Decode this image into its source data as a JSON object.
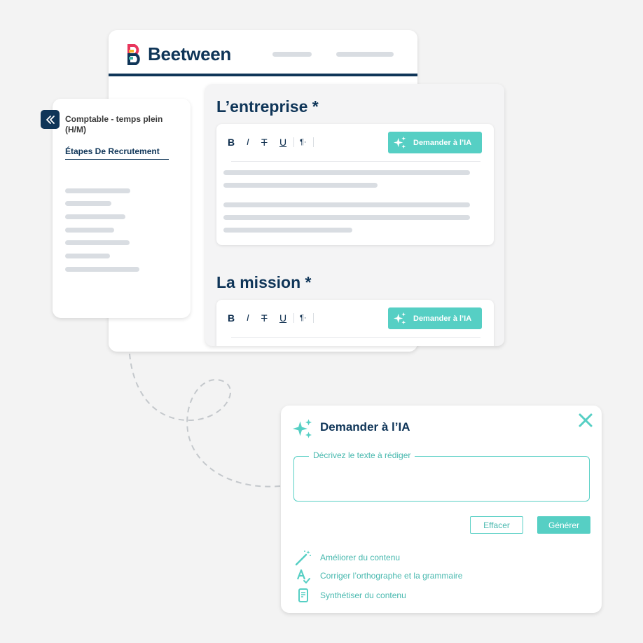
{
  "app": {
    "brand_name": "Beetween"
  },
  "sidebar": {
    "job_title": "Comptable - temps plein (H/M)",
    "steps_link": "Étapes De Recrutement"
  },
  "form": {
    "sections": [
      {
        "title": "L’entreprise *",
        "ai_button": "Demander à l’IA"
      },
      {
        "title": "La mission *",
        "ai_button": "Demander à l’IA"
      }
    ],
    "toolbar": {
      "bold": "B",
      "italic": "I",
      "strike": "T",
      "underline": "U",
      "paragraph": "¶·"
    }
  },
  "ai_dialog": {
    "title": "Demander à l’IA",
    "input_label": "Décrivez le texte à rédiger",
    "input_value": "",
    "clear_button": "Effacer",
    "generate_button": "Générer",
    "actions": [
      {
        "icon": "magic-wand-icon",
        "label": "Améliorer du contenu"
      },
      {
        "icon": "spellcheck-icon",
        "label": "Corriger l’orthographe et la grammaire"
      },
      {
        "icon": "document-icon",
        "label": "Synthétiser du contenu"
      }
    ]
  },
  "colors": {
    "navy": "#0f3558",
    "teal": "#56cfc4",
    "placeholder": "#d9dde2"
  }
}
